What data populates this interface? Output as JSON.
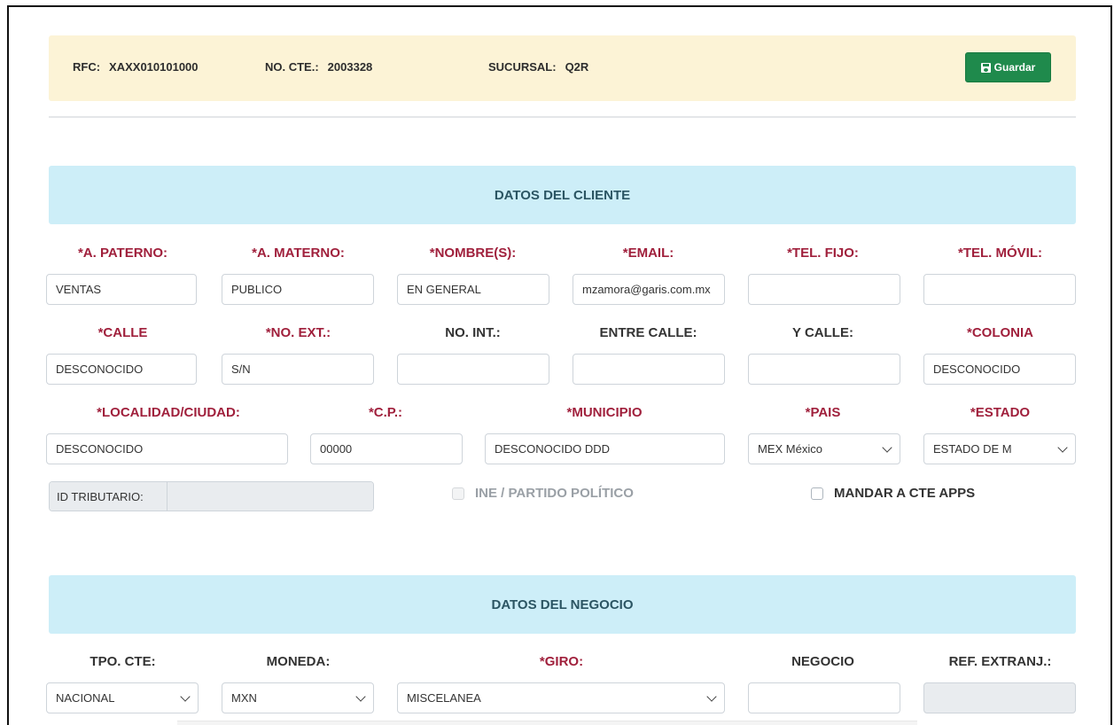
{
  "header": {
    "rfc_label": "RFC:",
    "rfc_value": "XAXX010101000",
    "cte_label": "NO. CTE.:",
    "cte_value": "2003328",
    "sucursal_label": "SUCURSAL:",
    "sucursal_value": "Q2R",
    "save_label": "Guardar",
    "save_icon": "floppy-disk-icon",
    "accent_color": "#1f8a4c",
    "bar_color": "#fcf3d6"
  },
  "cliente": {
    "title": "DATOS DEL CLIENTE",
    "a_paterno": {
      "label": "*A. PATERNO:",
      "value": "VENTAS"
    },
    "a_materno": {
      "label": "*A. MATERNO:",
      "value": "PUBLICO"
    },
    "nombre": {
      "label": "*NOMBRE(S):",
      "value": "EN GENERAL"
    },
    "email": {
      "label": "*EMAIL:",
      "value": "mzamora@garis.com.mx"
    },
    "tel_fijo": {
      "label": "*TEL. FIJO:",
      "value": ""
    },
    "tel_movil": {
      "label": "*TEL. MÓVIL:",
      "value": ""
    },
    "calle": {
      "label": "*CALLE",
      "value": "DESCONOCIDO"
    },
    "no_ext": {
      "label": "*NO. EXT.:",
      "value": "S/N"
    },
    "no_int": {
      "label": "NO. INT.:",
      "value": ""
    },
    "entre_calle": {
      "label": "ENTRE CALLE:",
      "value": ""
    },
    "y_calle": {
      "label": "Y CALLE:",
      "value": ""
    },
    "colonia": {
      "label": "*COLONIA",
      "value": "DESCONOCIDO"
    },
    "localidad": {
      "label": "*LOCALIDAD/CIUDAD:",
      "value": "DESCONOCIDO"
    },
    "cp": {
      "label": "*C.P.:",
      "value": "00000"
    },
    "municipio": {
      "label": "*MUNICIPIO",
      "value": "DESCONOCIDO DDD"
    },
    "pais": {
      "label": "*PAIS",
      "value": "MEX México"
    },
    "estado": {
      "label": "*ESTADO",
      "value": "ESTADO DE M"
    },
    "id_tributario_label": "ID TRIBUTARIO:",
    "ine_label": "INE / PARTIDO POLÍTICO",
    "mandar_label": "MANDAR A CTE APPS",
    "required_color": "#a0203c",
    "section_color": "#cdeef8"
  },
  "negocio": {
    "title": "DATOS DEL NEGOCIO",
    "tpo_cte": {
      "label": "TPO. CTE:",
      "value": "NACIONAL"
    },
    "moneda": {
      "label": "MONEDA:",
      "value": "MXN"
    },
    "giro": {
      "label": "*GIRO:",
      "value": "MISCELANEA"
    },
    "negocio": {
      "label": "NEGOCIO",
      "value": ""
    },
    "ref_extranj": {
      "label": "REF. EXTRANJ.:",
      "value": ""
    }
  }
}
